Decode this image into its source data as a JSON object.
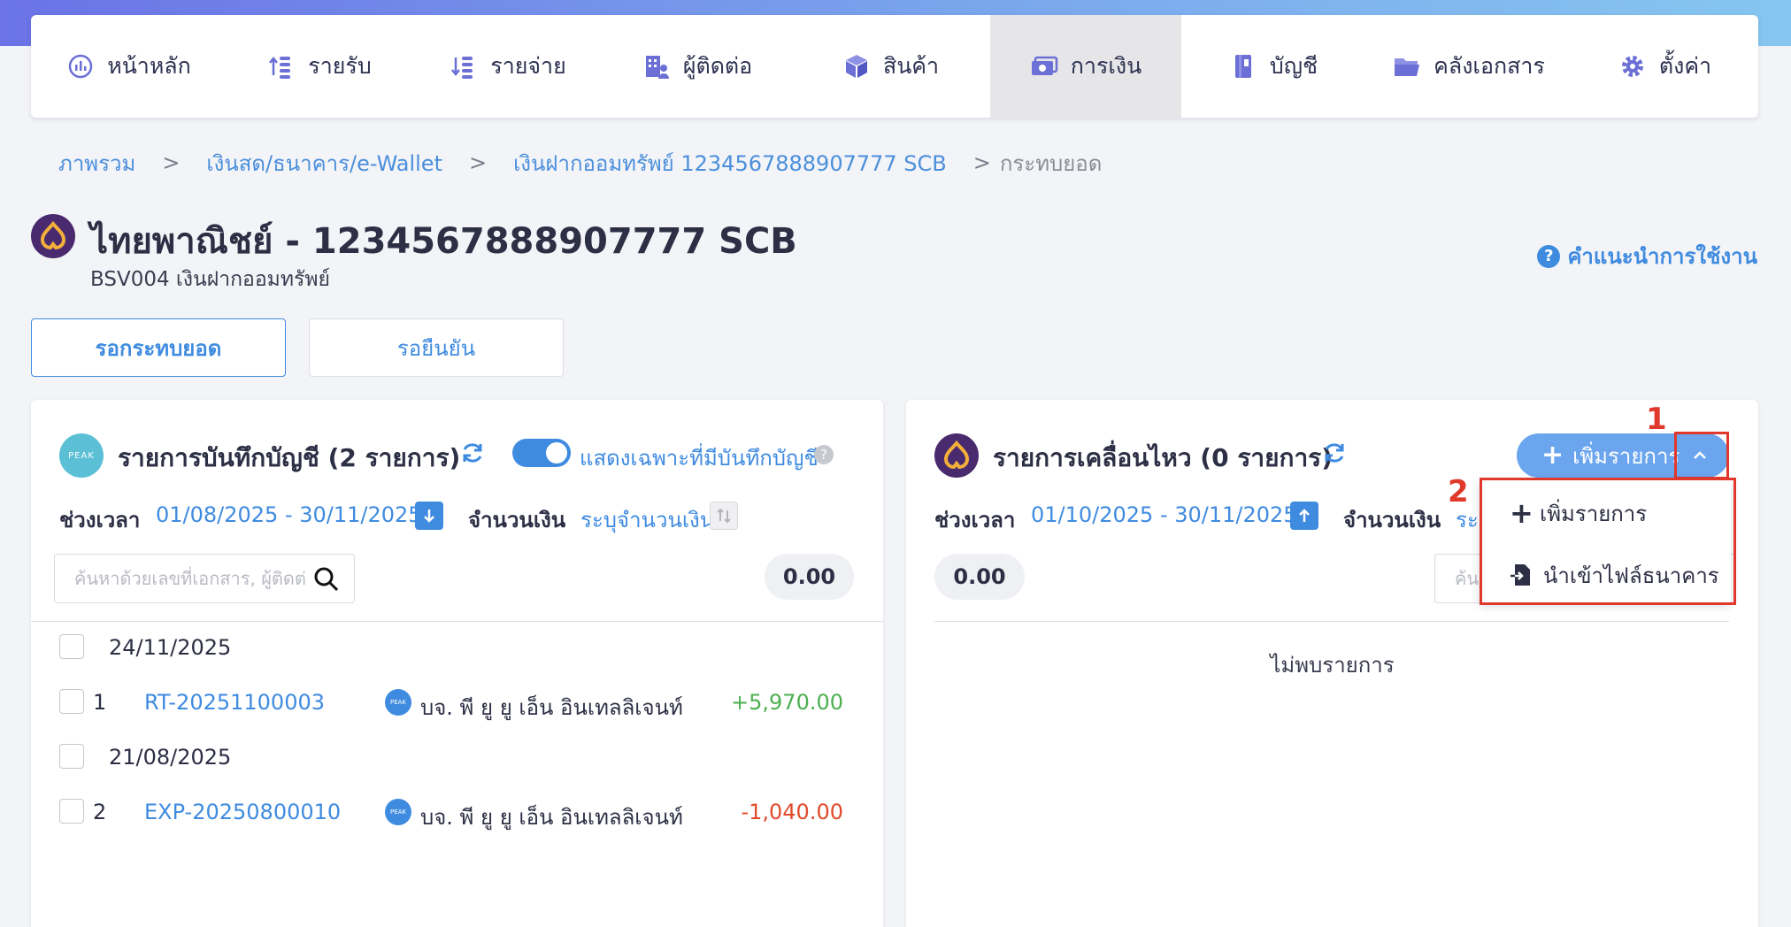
{
  "nav": {
    "items": [
      {
        "label": "หน้าหลัก",
        "icon": "dashboard-icon"
      },
      {
        "label": "รายรับ",
        "icon": "income-icon"
      },
      {
        "label": "รายจ่าย",
        "icon": "expense-icon"
      },
      {
        "label": "ผู้ติดต่อ",
        "icon": "contacts-icon"
      },
      {
        "label": "สินค้า",
        "icon": "product-box-icon"
      },
      {
        "label": "การเงิน",
        "icon": "money-icon"
      },
      {
        "label": "บัญชี",
        "icon": "ledger-book-icon"
      },
      {
        "label": "คลังเอกสาร",
        "icon": "folder-icon"
      },
      {
        "label": "ตั้งค่า",
        "icon": "gear-icon"
      }
    ],
    "active_index": 5
  },
  "breadcrumb": {
    "items": [
      "ภาพรวม",
      "เงินสด/ธนาคาร/e-Wallet",
      "เงินฝากออมทรัพย์ 1234567888907777 SCB"
    ],
    "separator": ">",
    "current": "กระทบยอด"
  },
  "header": {
    "title": "ไทยพาณิชย์ - 1234567888907777 SCB",
    "subtitle": "BSV004 เงินฝากออมทรัพย์",
    "help_label": "คำแนะนำการใช้งาน"
  },
  "tabs": {
    "active_label": "รอกระทบยอด",
    "inactive_label": "รอยืนยัน"
  },
  "left_panel": {
    "logo_text": "PEAK",
    "title": "รายการบันทึกบัญชี (2 รายการ)",
    "toggle_label": "แสดงเฉพาะที่มีบันทึกบัญชี",
    "toggle_on": true,
    "period_label": "ช่วงเวลา",
    "period_value": "01/08/2025 - 30/11/2025",
    "amount_label": "จำนวนเงิน",
    "amount_value": "ระบุจำนวนเงิน",
    "search_placeholder": "ค้นหาด้วยเลขที่เอกสาร, ผู้ติดต่อ",
    "total": "0.00",
    "groups": [
      {
        "date": "24/11/2025",
        "rows": [
          {
            "no": "1",
            "doc": "RT-20251100003",
            "contact_logo": "PEAK",
            "contact": "บจ. พี ยู ยู เอ็น อินเทลลิเจนท์",
            "amount": "+5,970.00",
            "type": "positive"
          }
        ]
      },
      {
        "date": "21/08/2025",
        "rows": [
          {
            "no": "2",
            "doc": "EXP-20250800010",
            "contact_logo": "PEAK",
            "contact": "บจ. พี ยู ยู เอ็น อินเทลลิเจนท์",
            "amount": "-1,040.00",
            "type": "negative"
          }
        ]
      }
    ]
  },
  "right_panel": {
    "title": "รายการเคลื่อนไหว (0 รายการ)",
    "add_button_label": "เพิ่มรายการ",
    "period_label": "ช่วงเวลา",
    "period_value": "01/10/2025 - 30/11/2025",
    "amount_label": "จำนวนเงิน",
    "amount_value_partial": "ระ",
    "total": "0.00",
    "search_placeholder_partial": "ค้น",
    "empty_message": "ไม่พบรายการ",
    "dropdown": {
      "items": [
        {
          "label": "เพิ่มรายการ",
          "icon": "plus-icon"
        },
        {
          "label": "นำเข้าไฟล์ธนาคาร",
          "icon": "file-import-icon"
        }
      ]
    },
    "annotations": {
      "marker_1": "1",
      "marker_2": "2"
    }
  },
  "colors": {
    "accent": "#3f8be0",
    "positive": "#4caf50",
    "negative": "#e04a2b",
    "highlight": "#e0382b",
    "scb_purple": "#4a2a6e",
    "scb_gold": "#f2b03a"
  }
}
